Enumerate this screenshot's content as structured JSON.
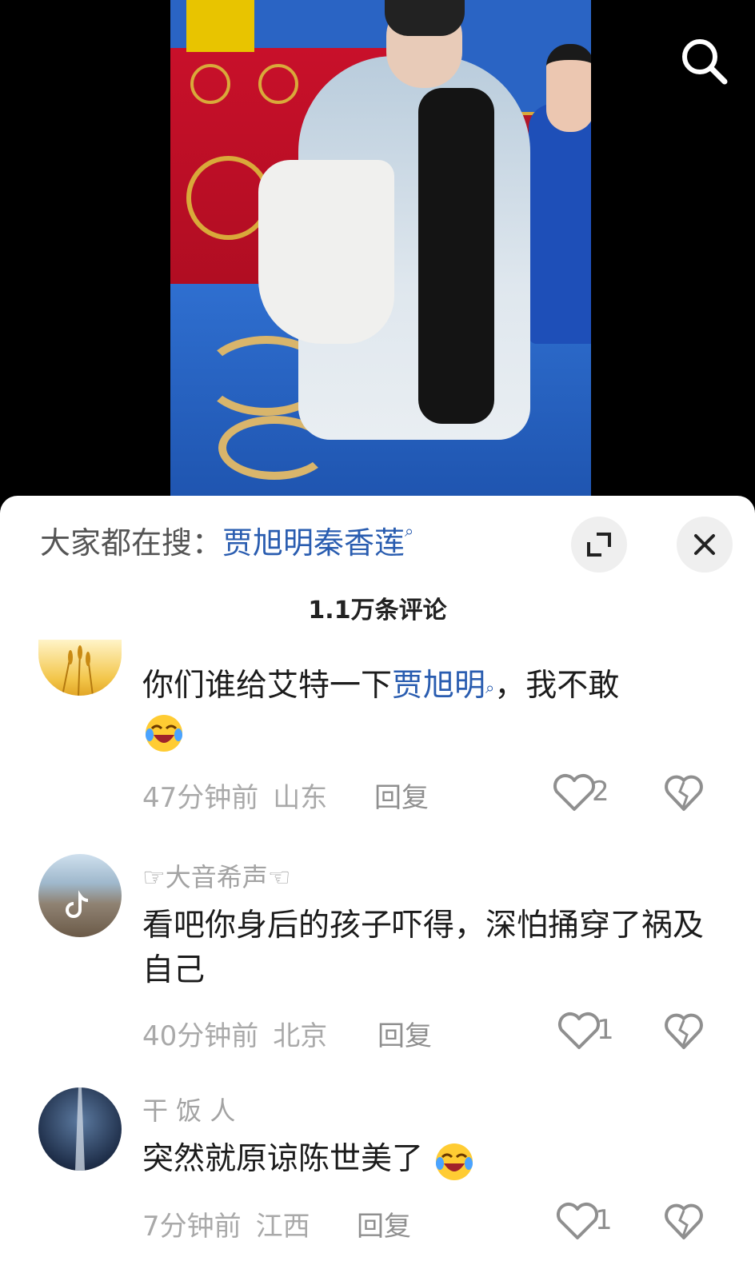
{
  "video": {
    "search_icon": "search-icon"
  },
  "comment_panel": {
    "hot_search_prefix": "大家都在搜：",
    "hot_search_keyword": "贾旭明秦香莲",
    "expand_icon": "expand-icon",
    "close_icon": "close-icon",
    "comment_count": "1.1万条评论"
  },
  "comments": [
    {
      "username": "",
      "text_before": "你们谁给艾特一下",
      "text_link": "贾旭明",
      "text_after": "，我不敢",
      "emoji": "laughing-crying-emoji",
      "time": "47分钟前",
      "location": "山东",
      "reply_label": "回复",
      "likes": "2"
    },
    {
      "username": "☞大音希声☜",
      "text": "看吧你身后的孩子吓得，深怕捅穿了祸及自己",
      "time": "40分钟前",
      "location": "北京",
      "reply_label": "回复",
      "likes": "1"
    },
    {
      "username": "干 饭 人",
      "text": "突然就原谅陈世美了",
      "emoji": "laughing-crying-emoji",
      "time": "7分钟前",
      "location": "江西",
      "reply_label": "回复",
      "likes": "1"
    }
  ],
  "colors": {
    "link_blue": "#2a5db0",
    "meta_gray": "#a9a9a9",
    "text_dark": "#1c1c1c"
  }
}
